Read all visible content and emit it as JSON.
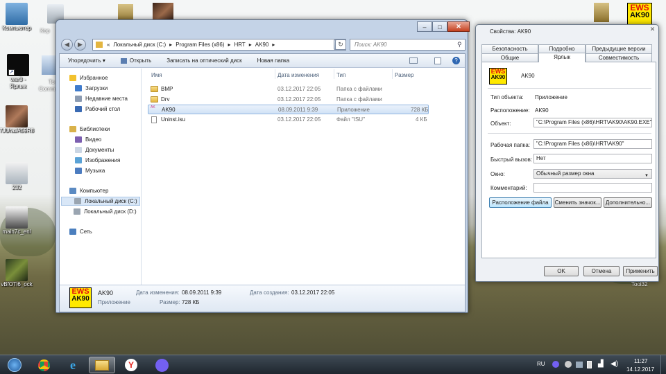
{
  "desktop": {
    "icons_left": [
      {
        "label": "Компьютер"
      },
      {
        "label": "war3 -"
      },
      {
        "label": "Ярлык"
      },
      {
        "label": "7JUraJA59R8"
      },
      {
        "label": "232"
      },
      {
        "label": "main7c_enl"
      },
      {
        "label": "vBfOTi6_ock"
      }
    ],
    "partial_labels": [
      "Кор",
      "То",
      "Comm"
    ],
    "right_label": "Tool32"
  },
  "explorer": {
    "breadcrumb": [
      "«",
      "Локальный диск (C:)",
      "▸",
      "Program Files (x86)",
      "▸",
      "HRT",
      "▸",
      "AK90",
      "▸"
    ],
    "search_placeholder": "Поиск: AK90",
    "toolbar": {
      "organize": "Упорядочить ▾",
      "open": "Открыть",
      "burn": "Записать на оптический диск",
      "new_folder": "Новая папка"
    },
    "nav": {
      "favorites": "Избранное",
      "downloads": "Загрузки",
      "recent": "Недавние места",
      "desktop": "Рабочий стол",
      "libraries": "Библиотеки",
      "video": "Видео",
      "documents": "Документы",
      "images": "Изображения",
      "music": "Музыка",
      "computer": "Компьютер",
      "drive_c": "Локальный диск (C:)",
      "drive_d": "Локальный диск (D:)",
      "network": "Сеть"
    },
    "columns": {
      "name": "Имя",
      "date": "Дата изменения",
      "type": "Тип",
      "size": "Размер"
    },
    "files": [
      {
        "name": "BMP",
        "date": "03.12.2017 22:05",
        "type": "Папка с файлами",
        "size": ""
      },
      {
        "name": "Drv",
        "date": "03.12.2017 22:05",
        "type": "Папка с файлами",
        "size": ""
      },
      {
        "name": "AK90",
        "date": "08.09.2011 9:39",
        "type": "Приложение",
        "size": "728 КБ"
      },
      {
        "name": "Uninst.isu",
        "date": "03.12.2017 22:05",
        "type": "Файл \"ISU\"",
        "size": "4 КБ"
      }
    ],
    "details": {
      "name": "AK90",
      "kind": "Приложение",
      "modified_label": "Дата изменения:",
      "modified_value": "08.09.2011 9:39",
      "created_label": "Дата создания:",
      "created_value": "03.12.2017 22:05",
      "size_label": "Размер:",
      "size_value": "728 КБ"
    },
    "logo": {
      "top": "EWS",
      "bottom": "AK90"
    }
  },
  "dialog": {
    "title": "Свойства: AK90",
    "tabs_row1": [
      "Безопасность",
      "Подробно",
      "Предыдущие версии"
    ],
    "tabs_row2": [
      "Общие",
      "Ярлык",
      "Совместимость"
    ],
    "name": "AK90",
    "labels": {
      "object_type": "Тип объекта:",
      "location": "Расположение:",
      "object": "Объект:",
      "workdir": "Рабочая папка:",
      "hotkey": "Быстрый вызов:",
      "window": "Окно:",
      "comment": "Комментарий:"
    },
    "values": {
      "object_type": "Приложение",
      "location": "AK90",
      "object": "\"C:\\Program Files (x86)\\HRT\\AK90\\AK90.EXE\"",
      "workdir": "\"C:\\Program Files (x86)\\HRT\\AK90\"",
      "hotkey": "Нет",
      "window": "Обычный размер окна",
      "comment": ""
    },
    "buttons": {
      "file_location": "Расположение файла",
      "change_icon": "Сменить значок...",
      "advanced": "Дополнительно...",
      "ok": "OK",
      "cancel": "Отмена",
      "apply": "Применить"
    },
    "logo": {
      "top": "EWS",
      "bottom": "AK90"
    }
  },
  "taskbar": {
    "lang": "RU",
    "time": "11:27",
    "date": "14.12.2017"
  },
  "colors": {
    "ews_yellow": "#ffe900",
    "ews_red": "#e20e0e",
    "explorer_frame": "#c4d3e7",
    "taskbar": "#2a333c"
  }
}
